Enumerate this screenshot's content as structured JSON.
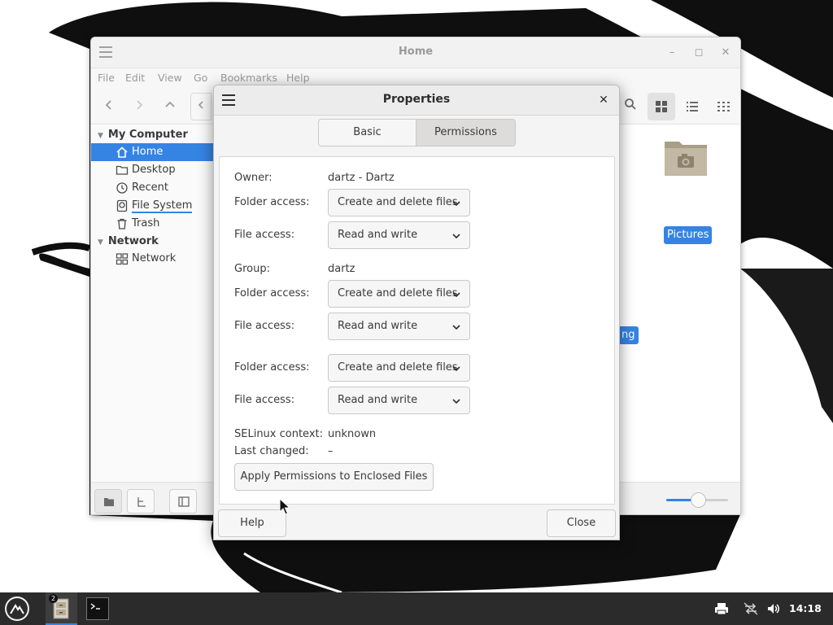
{
  "file_manager": {
    "title": "Home",
    "menu": [
      "File",
      "Edit",
      "View",
      "Go",
      "Bookmarks",
      "Help"
    ],
    "sidebar": {
      "sections": [
        {
          "label": "My Computer",
          "items": [
            {
              "label": "Home",
              "icon": "home-icon",
              "active": true
            },
            {
              "label": "Desktop",
              "icon": "folder-icon"
            },
            {
              "label": "Recent",
              "icon": "clock-icon"
            },
            {
              "label": "File System",
              "icon": "drive-icon"
            },
            {
              "label": "Trash",
              "icon": "trash-icon"
            }
          ]
        },
        {
          "label": "Network",
          "items": [
            {
              "label": "Network",
              "icon": "network-icon"
            }
          ]
        }
      ]
    },
    "content": {
      "pictures_label": "Pictures",
      "partial_label": "ng"
    }
  },
  "dialog": {
    "title": "Properties",
    "tabs": {
      "basic": "Basic",
      "permissions": "Permissions",
      "active": "Permissions"
    },
    "owner": {
      "label": "Owner:",
      "value": "dartz - Dartz",
      "folder_access_label": "Folder access:",
      "folder_access": "Create and delete files",
      "file_access_label": "File access:",
      "file_access": "Read and write"
    },
    "group": {
      "label": "Group:",
      "value": "dartz",
      "folder_access_label": "Folder access:",
      "folder_access": "Create and delete files",
      "file_access_label": "File access:",
      "file_access": "Read and write"
    },
    "others": {
      "folder_access_label": "Folder access:",
      "folder_access": "Create and delete files",
      "file_access_label": "File access:",
      "file_access": "Read and write"
    },
    "selinux": {
      "label": "SELinux context:",
      "value": "unknown"
    },
    "last_changed": {
      "label": "Last changed:",
      "value": "–"
    },
    "apply_button": "Apply Permissions to Enclosed Files",
    "help_button": "Help",
    "close_button": "Close"
  },
  "taskbar": {
    "clock": "14:18",
    "badge_count": "2"
  },
  "colors": {
    "accent": "#3584e4",
    "taskbar": "#2b2b2b"
  }
}
